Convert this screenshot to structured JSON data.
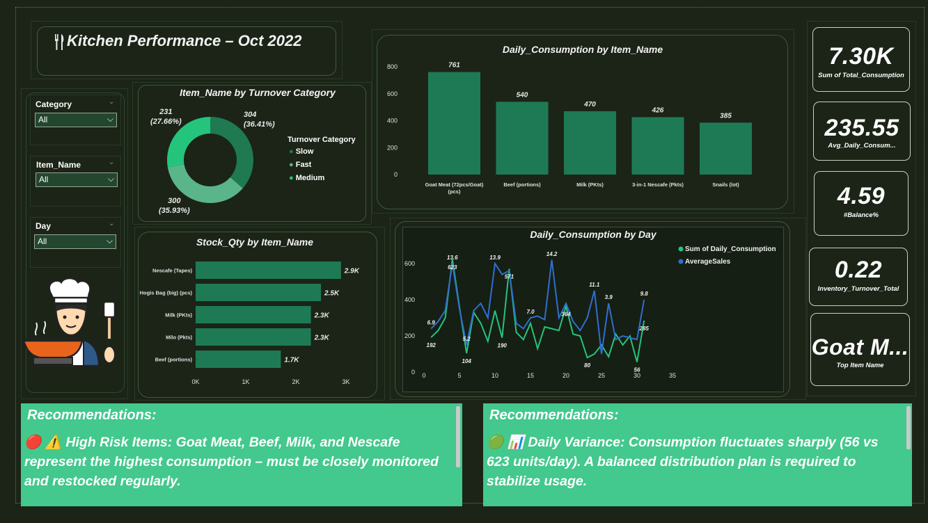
{
  "header": {
    "title": "Kitchen Performance – Oct 2022",
    "icon": "fork-knife-icon"
  },
  "filters": [
    {
      "label": "Category",
      "value": "All"
    },
    {
      "label": "Item_Name",
      "value": "All"
    },
    {
      "label": "Day",
      "value": "All"
    }
  ],
  "kpis": [
    {
      "value": "7.30K",
      "label": "Sum of Total_Consumption"
    },
    {
      "value": "235.55",
      "label": "Avg_Daily_Consum..."
    },
    {
      "value": "4.59",
      "label": "#Balance%"
    },
    {
      "value": "0.22",
      "label": "Inventory_Turnover_Total"
    },
    {
      "value": "Goat M...",
      "label": "Top Item Name"
    }
  ],
  "donut": {
    "title": "Item_Name by Turnover Category",
    "legend_title": "Turnover Category",
    "legend": [
      {
        "name": "Slow",
        "color": "#1f7a52"
      },
      {
        "name": "Fast",
        "color": "#5ab58a"
      },
      {
        "name": "Medium",
        "color": "#25c47c"
      }
    ],
    "labels": [
      {
        "value": "304",
        "pct": "(36.41%)"
      },
      {
        "value": "300",
        "pct": "(35.93%)"
      },
      {
        "value": "231",
        "pct": "(27.66%)"
      }
    ]
  },
  "recommendations": [
    {
      "heading": "Recommendations:",
      "icons": "🔴 ⚠️",
      "text": "High Risk Items: Goat Meat, Beef, Milk, and Nescafe represent the highest consumption – must be closely monitored and restocked regularly."
    },
    {
      "heading": "Recommendations:",
      "icons": "🟢 📊",
      "text": "Daily Variance: Consumption fluctuates sharply (56 vs 623 units/day). A balanced distribution plan is required to stabilize usage."
    }
  ],
  "chart_data": [
    {
      "type": "bar",
      "title": "Daily_Consumption by Item_Name",
      "categories": [
        "Goat Meat (72pcs/Goat) (pcs)",
        "Beef (portions)",
        "Milk (PKts)",
        "3-in-1 Nescafe (Pkts)",
        "Snails (lot)"
      ],
      "values": [
        761,
        540,
        470,
        426,
        385
      ],
      "data_labels": [
        "761",
        "540",
        "470",
        "426",
        "385"
      ],
      "yticks": [
        "0",
        "200",
        "400",
        "600",
        "800"
      ],
      "ylim": [
        0,
        800
      ],
      "color": "#1e7a55"
    },
    {
      "type": "pie",
      "title": "Item_Name by Turnover Category",
      "categories": [
        "Slow",
        "Fast",
        "Medium"
      ],
      "values": [
        304,
        300,
        231
      ],
      "colors": [
        "#1f7a52",
        "#5ab58a",
        "#25c47c"
      ]
    },
    {
      "type": "bar",
      "orientation": "horizontal",
      "title": "Stock_Qty by Item_Name",
      "categories": [
        "Nescafe (Tapes)",
        "Hogis Bag (big) (pcs)",
        "Milk (PKts)",
        "Milo (Pkts)",
        "Beef (portions)"
      ],
      "values": [
        2900,
        2500,
        2300,
        2300,
        1700
      ],
      "data_labels": [
        "2.9K",
        "2.5K",
        "2.3K",
        "2.3K",
        "1.7K"
      ],
      "xticks": [
        "0K",
        "1K",
        "2K",
        "3K"
      ],
      "xlim": [
        0,
        3000
      ],
      "color": "#1e7a55"
    },
    {
      "type": "line",
      "title": "Daily_Consumption by Day",
      "x": [
        1,
        2,
        3,
        4,
        5,
        6,
        7,
        8,
        9,
        10,
        11,
        12,
        13,
        14,
        15,
        16,
        17,
        18,
        19,
        20,
        21,
        22,
        23,
        24,
        25,
        26,
        27,
        28,
        29,
        30,
        31
      ],
      "xticks": [
        "0",
        "5",
        "10",
        "15",
        "20",
        "25",
        "30",
        "35"
      ],
      "xlim": [
        0,
        35
      ],
      "yticks": [
        "0",
        "200",
        "400",
        "600"
      ],
      "ylim": [
        0,
        700
      ],
      "series": [
        {
          "name": "Sum of Daily_Consumption",
          "color": "#25c47c",
          "values": [
            192,
            230,
            300,
            623,
            360,
            104,
            330,
            270,
            170,
            340,
            190,
            571,
            220,
            180,
            270,
            130,
            250,
            240,
            230,
            364,
            210,
            200,
            80,
            100,
            150,
            85,
            210,
            150,
            200,
            56,
            285
          ],
          "labels": [
            {
              "i": 0,
              "t": "192"
            },
            {
              "i": 3,
              "t": "623"
            },
            {
              "i": 5,
              "t": "104"
            },
            {
              "i": 10,
              "t": "190"
            },
            {
              "i": 11,
              "t": "571"
            },
            {
              "i": 19,
              "t": "364"
            },
            {
              "i": 22,
              "t": "80"
            },
            {
              "i": 29,
              "t": "56"
            },
            {
              "i": 30,
              "t": "285"
            }
          ]
        },
        {
          "name": "AverageSales",
          "color": "#2f6fd1",
          "values": [
            240,
            280,
            340,
            600,
            350,
            150,
            340,
            380,
            300,
            600,
            540,
            560,
            270,
            240,
            300,
            310,
            290,
            620,
            300,
            380,
            280,
            230,
            300,
            450,
            100,
            380,
            180,
            200,
            190,
            180,
            400
          ],
          "labels": [
            {
              "i": 0,
              "t": "6.9"
            },
            {
              "i": 3,
              "t": "13.6"
            },
            {
              "i": 5,
              "t": "5.2"
            },
            {
              "i": 9,
              "t": "13.9"
            },
            {
              "i": 14,
              "t": "7.0"
            },
            {
              "i": 17,
              "t": "14.2"
            },
            {
              "i": 23,
              "t": "11.1"
            },
            {
              "i": 25,
              "t": "3.9"
            },
            {
              "i": 30,
              "t": "9.8"
            }
          ]
        }
      ]
    }
  ]
}
